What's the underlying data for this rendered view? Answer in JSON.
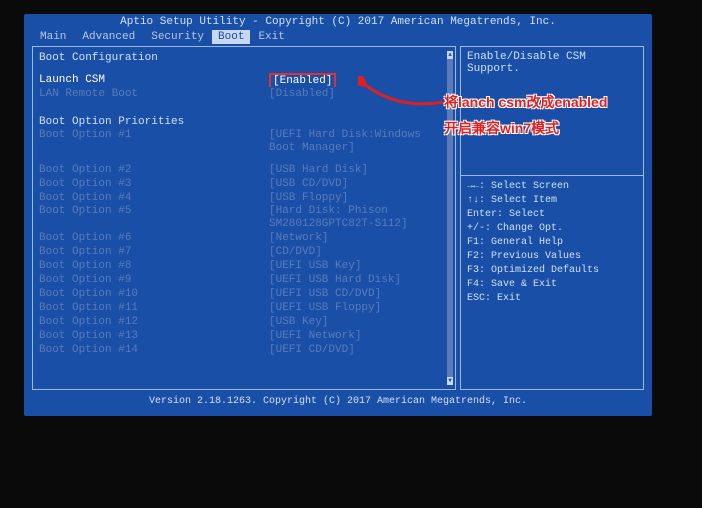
{
  "title": "Aptio Setup Utility - Copyright (C) 2017 American Megatrends, Inc.",
  "menu": {
    "main": "Main",
    "advanced": "Advanced",
    "security": "Security",
    "boot": "Boot",
    "exit": "Exit"
  },
  "left": {
    "section1": "Boot Configuration",
    "launch_csm": "Launch CSM",
    "launch_csm_val": "[Enabled]",
    "lan_remote": "LAN Remote Boot",
    "lan_remote_val": "[Disabled]",
    "section2": "Boot Option Priorities",
    "opt1": "Boot Option #1",
    "opt1_val": "[UEFI Hard Disk:Windows Boot Manager]",
    "opt2": "Boot Option #2",
    "opt2_val": "[USB Hard Disk]",
    "opt3": "Boot Option #3",
    "opt3_val": "[USB CD/DVD]",
    "opt4": "Boot Option #4",
    "opt4_val": "[USB Floppy]",
    "opt5": "Boot Option #5",
    "opt5_val": "[Hard Disk: Phison SM280128GPTC82T-S112]",
    "opt6": "Boot Option #6",
    "opt6_val": "[Network]",
    "opt7": "Boot Option #7",
    "opt7_val": "[CD/DVD]",
    "opt8": "Boot Option #8",
    "opt8_val": "[UEFI USB Key]",
    "opt9": "Boot Option #9",
    "opt9_val": "[UEFI USB Hard Disk]",
    "opt10": "Boot Option #10",
    "opt10_val": "[UEFI USB CD/DVD]",
    "opt11": "Boot Option #11",
    "opt11_val": "[UEFI USB Floppy]",
    "opt12": "Boot Option #12",
    "opt12_val": "[USB Key]",
    "opt13": "Boot Option #13",
    "opt13_val": "[UEFI Network]",
    "opt14": "Boot Option #14",
    "opt14_val": "[UEFI CD/DVD]"
  },
  "right": {
    "help_text": "Enable/Disable CSM Support.",
    "k1": "→←: Select Screen",
    "k2": "↑↓: Select Item",
    "k3": "Enter: Select",
    "k4": "+/-: Change Opt.",
    "k5": "F1: General Help",
    "k6": "F2: Previous Values",
    "k7": "F3: Optimized Defaults",
    "k8": "F4: Save & Exit",
    "k9": "ESC: Exit"
  },
  "footer": "Version 2.18.1263. Copyright (C) 2017 American Megatrends, Inc.",
  "annotation": {
    "line1": "将lanch csm改成enabled",
    "line2": "开启兼容win7模式"
  }
}
